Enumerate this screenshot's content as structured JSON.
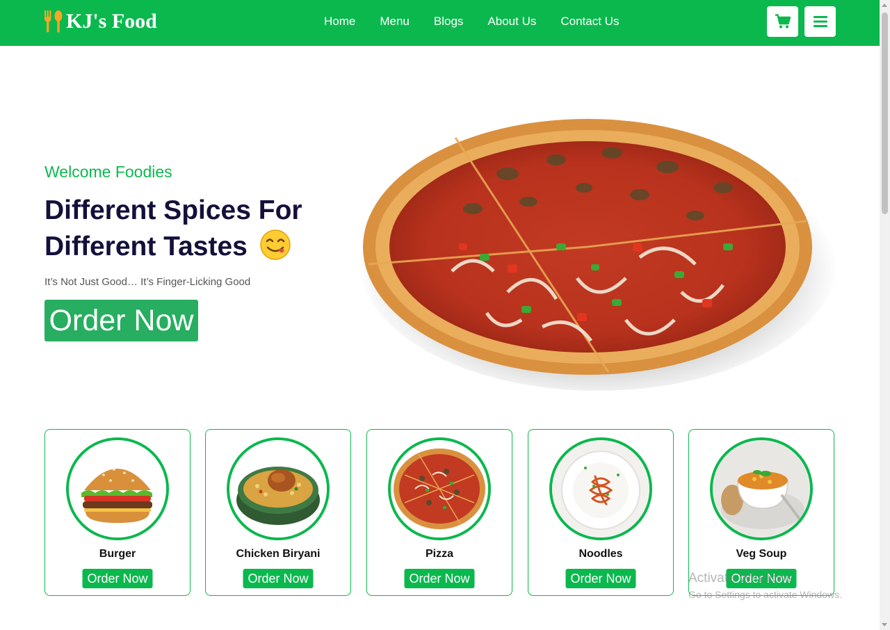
{
  "brand": {
    "name": "KJ's Food",
    "accent": "#0bb84e",
    "logo_icon": "fork-spoon-icon"
  },
  "nav": {
    "links": [
      "Home",
      "Menu",
      "Blogs",
      "About Us",
      "Contact Us"
    ]
  },
  "header_buttons": {
    "cart_icon": "cart-icon",
    "menu_icon": "hamburger-icon"
  },
  "hero": {
    "subtitle": "Welcome Foodies",
    "title_line1": "Different Spices For",
    "title_line2": "Different Tastes",
    "tagline": "It’s Not Just Good… It’s Finger-Licking Good",
    "cta": "Order Now",
    "image": "pizza"
  },
  "menu_items": [
    {
      "name": "Burger",
      "cta": "Order Now"
    },
    {
      "name": "Chicken Biryani",
      "cta": "Order Now"
    },
    {
      "name": "Pizza",
      "cta": "Order Now"
    },
    {
      "name": "Noodles",
      "cta": "Order Now"
    },
    {
      "name": "Veg Soup",
      "cta": "Order Now"
    }
  ],
  "watermark": {
    "line1": "Activate Windows",
    "line2": "Go to Settings to activate Windows."
  }
}
